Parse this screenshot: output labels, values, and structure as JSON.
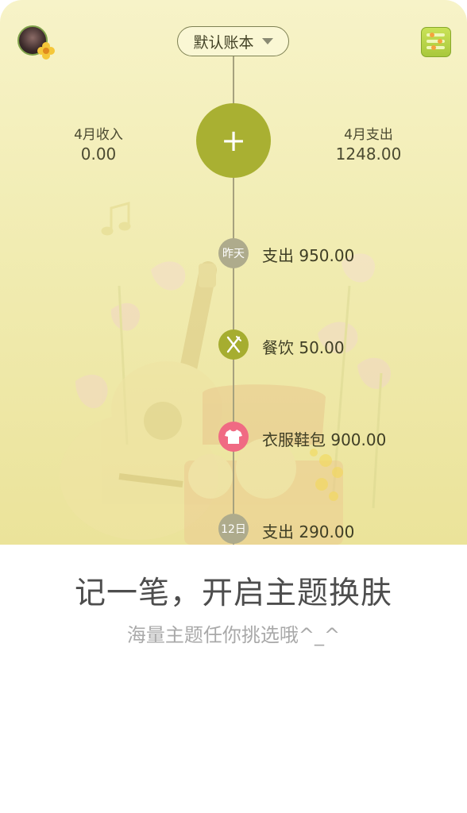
{
  "header": {
    "book_name": "默认账本",
    "avatar_icon": "user-avatar",
    "menu_icon": "settings-sliders-icon"
  },
  "summary": {
    "income_label": "4月收入",
    "income_value": "0.00",
    "expense_label": "4月支出",
    "expense_value": "1248.00"
  },
  "add_button": {
    "label": "+"
  },
  "timeline": {
    "entries": [
      {
        "badge": "昨天",
        "icon": "day-badge",
        "text": "支出 950.00",
        "color": "#aeab8c"
      },
      {
        "badge": "",
        "icon": "fork-knife-icon",
        "text": "餐饮 50.00",
        "color": "#a6ad30"
      },
      {
        "badge": "",
        "icon": "tshirt-icon",
        "text": "衣服鞋包 900.00",
        "color": "#f06a83"
      },
      {
        "badge": "12日",
        "icon": "day-badge",
        "text": "支出 290.00",
        "color": "#aeab8c"
      }
    ]
  },
  "promo": {
    "headline": "记一笔，开启主题换肤",
    "subline": "海量主题任你挑选哦^_^"
  },
  "colors": {
    "accent": "#a9b032",
    "clothes": "#f06a83",
    "theme_bg": "#f1ecb2"
  }
}
